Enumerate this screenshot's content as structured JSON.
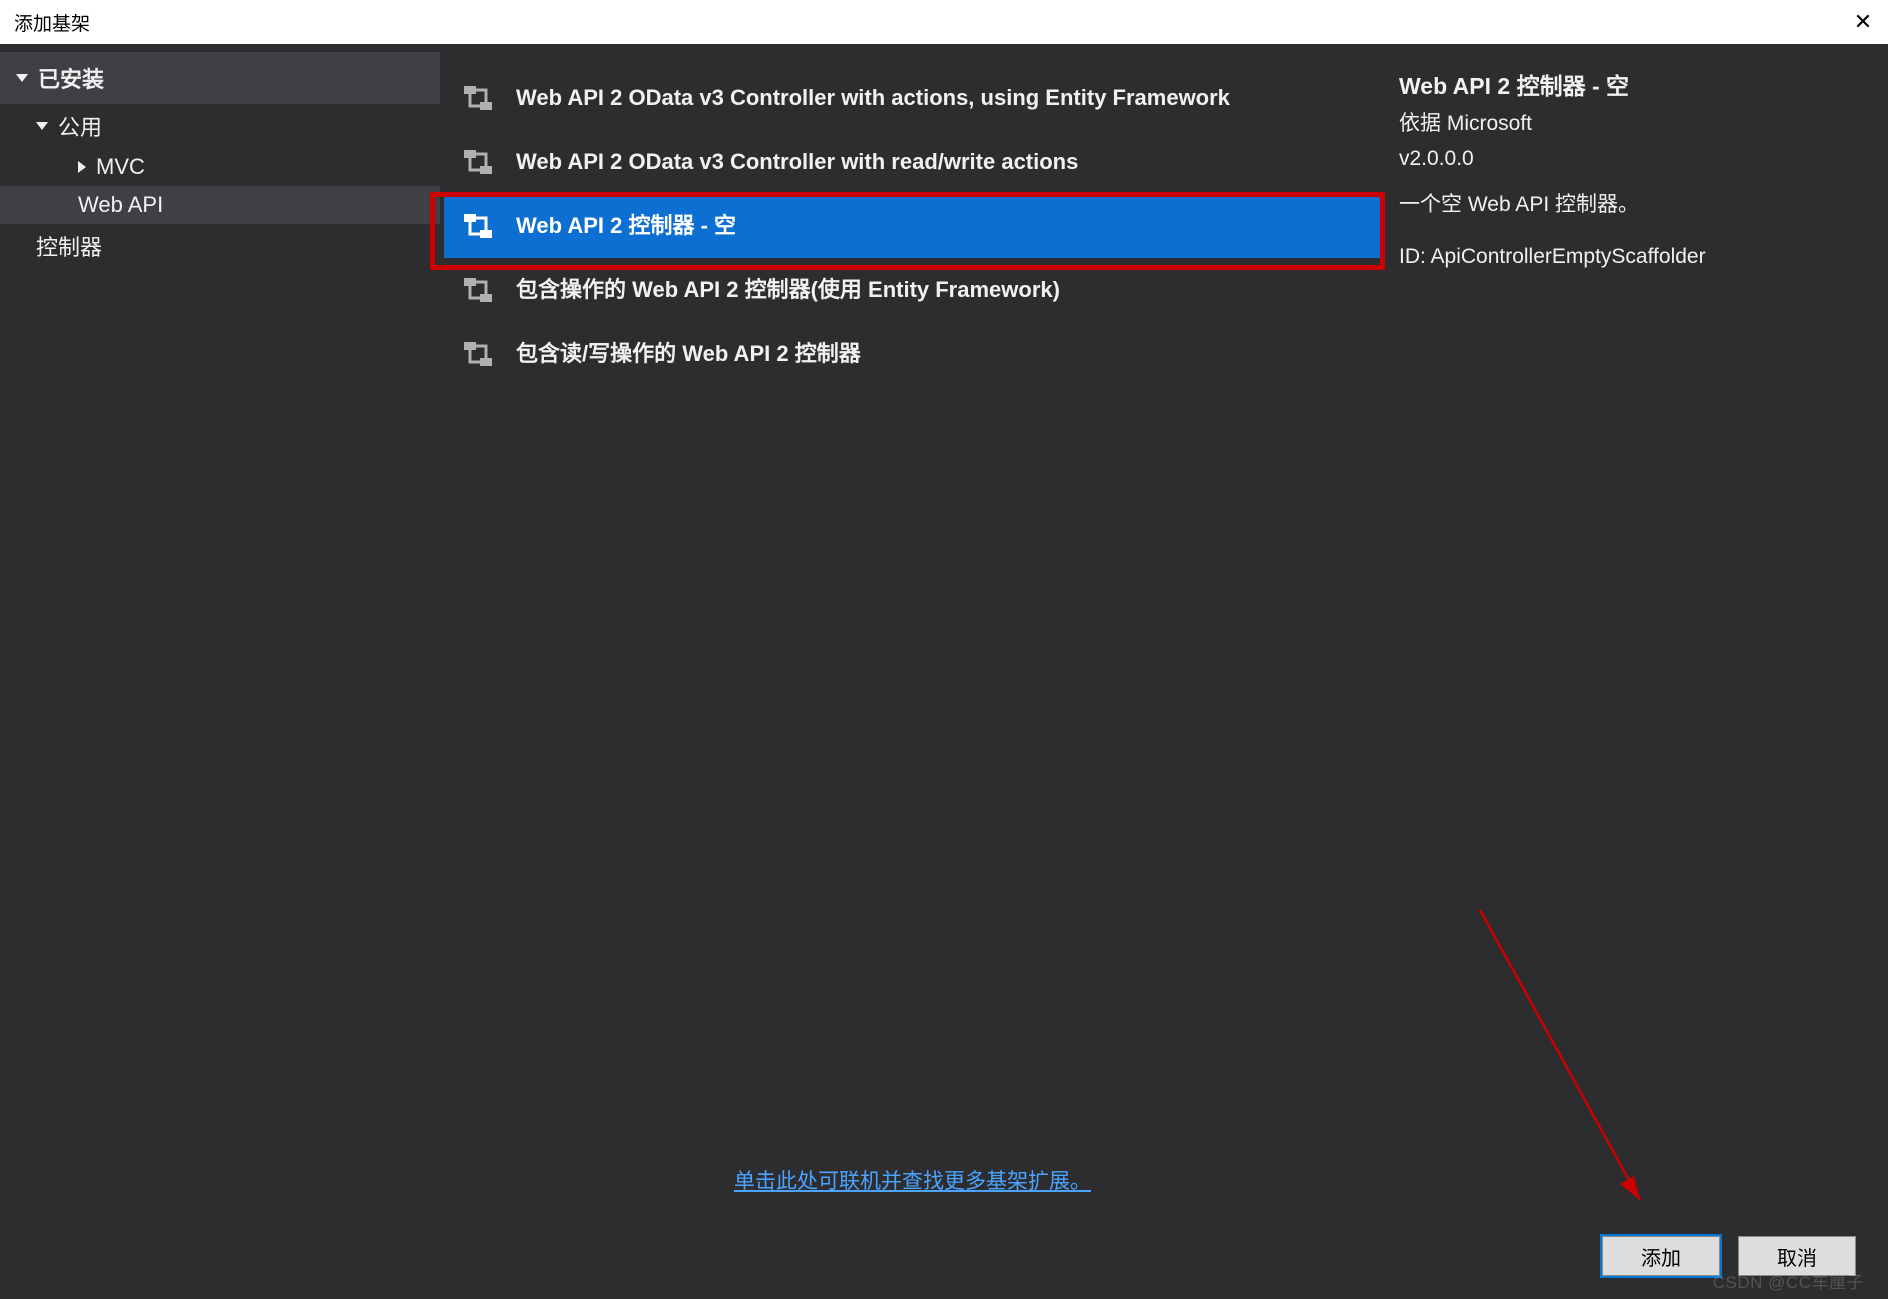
{
  "titlebar": {
    "title": "添加基架",
    "close_glyph": "✕"
  },
  "sidebar": {
    "installed_label": "已安装",
    "items": [
      {
        "label": "公用",
        "expanded": true
      },
      {
        "label": "MVC"
      },
      {
        "label": "Web API",
        "selected": true
      },
      {
        "label": "控制器"
      }
    ]
  },
  "scaffolds": {
    "items": [
      {
        "label": "Web API 2 OData v3 Controller with actions, using Entity Framework"
      },
      {
        "label": "Web API 2 OData v3 Controller with read/write actions"
      },
      {
        "label": "Web API 2 控制器 - 空",
        "selected": true
      },
      {
        "label": "包含操作的 Web API 2 控制器(使用 Entity Framework)"
      },
      {
        "label": "包含读/写操作的 Web API 2 控制器"
      }
    ],
    "more_link": "单击此处可联机并查找更多基架扩展。"
  },
  "details": {
    "title": "Web API 2 控制器 - 空",
    "by_label": "依据 Microsoft",
    "version": "v2.0.0.0",
    "description": "一个空 Web API 控制器。",
    "id_label": "ID: ApiControllerEmptyScaffolder"
  },
  "footer": {
    "add_label": "添加",
    "cancel_label": "取消"
  },
  "watermark": "CSDN @CC车厘子"
}
